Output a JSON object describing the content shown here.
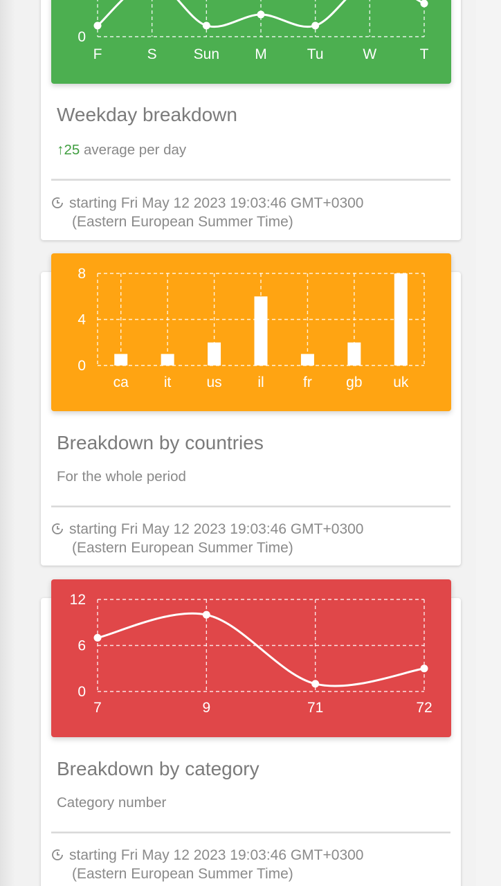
{
  "colors": {
    "weekday_panel": "#4caf50",
    "countries_panel": "#ffa412",
    "category_panel": "#e04749"
  },
  "cards": [
    {
      "title": "Weekday breakdown",
      "subtitle_icon": "arrow-up-icon",
      "subtitle_value": "25",
      "subtitle_text": "average per day",
      "footer_icon": "clock-icon",
      "footer_line1": "starting Fri May 12 2023 19:03:46 GMT+0300",
      "footer_line2": "(Eastern European Summer Time)"
    },
    {
      "title": "Breakdown by countries",
      "subtitle_text": "For the whole period",
      "footer_icon": "clock-icon",
      "footer_line1": "starting Fri May 12 2023 19:03:46 GMT+0300",
      "footer_line2": "(Eastern European Summer Time)"
    },
    {
      "title": "Breakdown by category",
      "subtitle_text": "Category number",
      "footer_icon": "clock-icon",
      "footer_line1": "starting Fri May 12 2023 19:03:46 GMT+0300",
      "footer_line2": "(Eastern European Summer Time)"
    }
  ],
  "chart_data": [
    {
      "type": "line",
      "categories": [
        "F",
        "S",
        "Sun",
        "M",
        "Tu",
        "W",
        "T"
      ],
      "values": [
        1,
        5,
        1,
        2,
        1,
        5,
        3
      ],
      "ytick_labels": [
        "0"
      ],
      "ylim": [
        0,
        3
      ],
      "grid": true
    },
    {
      "type": "bar",
      "categories": [
        "ca",
        "it",
        "us",
        "il",
        "fr",
        "gb",
        "uk"
      ],
      "values": [
        1,
        1,
        2,
        6,
        1,
        2,
        8
      ],
      "ytick_labels": [
        "0",
        "4",
        "8"
      ],
      "ylim": [
        0,
        8
      ],
      "grid": true
    },
    {
      "type": "line",
      "categories": [
        "7",
        "9",
        "71",
        "72"
      ],
      "values": [
        7,
        10,
        1,
        3
      ],
      "ytick_labels": [
        "0",
        "6",
        "12"
      ],
      "ylim": [
        0,
        12
      ],
      "grid": true
    }
  ]
}
